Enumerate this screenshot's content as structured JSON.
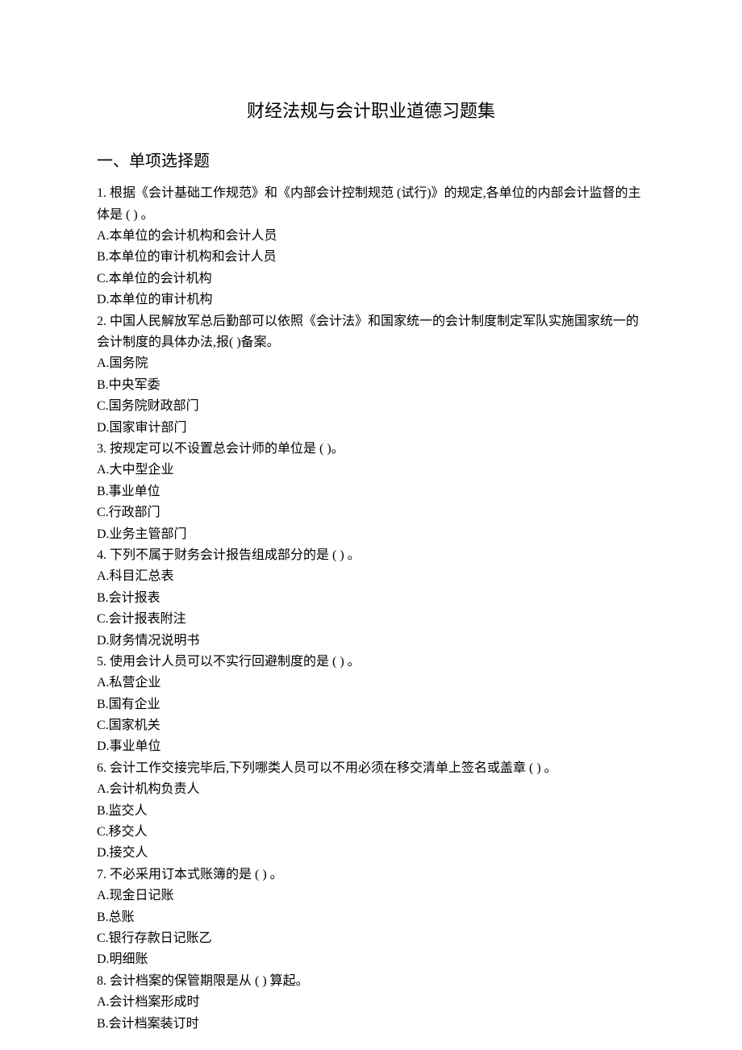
{
  "title": "财经法规与会计职业道德习题集",
  "section": "一、单项选择题",
  "questions": [
    {
      "num": "1.",
      "text": "根据《会计基础工作规范》和《内部会计控制规范 (试行)》的规定,各单位的内部会计监督的主体是 ( ) 。",
      "opts": [
        "A.本单位的会计机构和会计人员",
        "B.本单位的审计机构和会计人员",
        "C.本单位的会计机构",
        "D.本单位的审计机构"
      ]
    },
    {
      "num": "2.",
      "text": "中国人民解放军总后勤部可以依照《会计法》和国家统一的会计制度制定军队实施国家统一的会计制度的具体办法,报( )备案。",
      "opts": [
        "A.国务院",
        "B.中央军委",
        "C.国务院财政部门",
        "D.国家审计部门"
      ]
    },
    {
      "num": "3.",
      "text": "按规定可以不设置总会计师的单位是 ( )。",
      "opts": [
        "A.大中型企业",
        "B.事业单位",
        "C.行政部门",
        "D.业务主管部门"
      ]
    },
    {
      "num": "4.",
      "text": "下列不属于财务会计报告组成部分的是 ( ) 。",
      "opts": [
        "A.科目汇总表",
        "B.会计报表",
        "C.会计报表附注",
        "D.财务情况说明书"
      ]
    },
    {
      "num": "5.",
      "text": "使用会计人员可以不实行回避制度的是 ( ) 。",
      "opts": [
        "A.私营企业",
        "B.国有企业",
        "C.国家机关",
        "D.事业单位"
      ]
    },
    {
      "num": "6.",
      "text": "会计工作交接完毕后,下列哪类人员可以不用必须在移交清单上签名或盖章 ( ) 。",
      "opts": [
        "A.会计机构负责人",
        "B.监交人",
        "C.移交人",
        "D.接交人"
      ]
    },
    {
      "num": "7.",
      "text": "不必采用订本式账簿的是 ( ) 。",
      "opts": [
        "A.现金日记账",
        "B.总账",
        "C.银行存款日记账乙",
        "D.明细账"
      ]
    },
    {
      "num": "8.",
      "text": "会计档案的保管期限是从 ( ) 算起。",
      "opts": [
        "A.会计档案形成时",
        "B.会计档案装订时"
      ]
    }
  ]
}
